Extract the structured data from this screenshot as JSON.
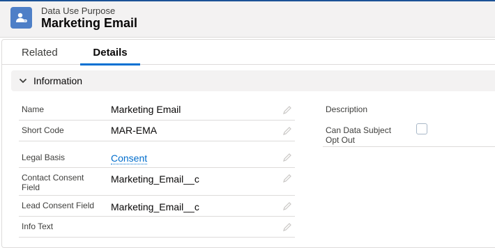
{
  "header": {
    "object_label": "Data Use Purpose",
    "record_title": "Marketing Email",
    "icon": "data-use-purpose-icon",
    "icon_color": "#4e7fc7"
  },
  "tabs": [
    {
      "label": "Related",
      "active": false
    },
    {
      "label": "Details",
      "active": true
    }
  ],
  "section": {
    "title": "Information",
    "expanded": true
  },
  "left_fields": [
    {
      "label": "Name",
      "value": "Marketing Email"
    },
    {
      "label": "Short Code",
      "value": "MAR-EMA"
    },
    {
      "label": "Legal Basis",
      "value": "Consent",
      "link": true
    },
    {
      "label": "Contact Consent Field",
      "value": "Marketing_Email__c"
    },
    {
      "label": "Lead Consent Field",
      "value": "Marketing_Email__c"
    },
    {
      "label": "Info Text",
      "value": ""
    }
  ],
  "right_fields": [
    {
      "label": "Description",
      "value": ""
    },
    {
      "label": "Can Data Subject Opt Out",
      "checked": false
    }
  ],
  "colors": {
    "accent": "#0070d2",
    "link": "#006dcc",
    "header_bg": "#f3f2f2"
  }
}
